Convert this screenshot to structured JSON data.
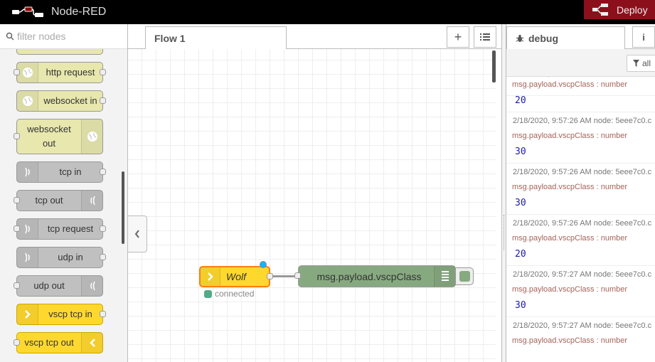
{
  "header": {
    "title": "Node-RED",
    "deploy_label": "Deploy"
  },
  "palette": {
    "search_placeholder": "filter nodes",
    "nodes": [
      {
        "label": "http request"
      },
      {
        "label": "websocket in"
      },
      {
        "label": "websocket out"
      },
      {
        "label": "tcp in"
      },
      {
        "label": "tcp out"
      },
      {
        "label": "tcp request"
      },
      {
        "label": "udp in"
      },
      {
        "label": "udp out"
      },
      {
        "label": "vscp tcp in"
      },
      {
        "label": "vscp tcp out"
      }
    ]
  },
  "workspace": {
    "tabs": [
      {
        "label": "Flow 1"
      }
    ],
    "nodes": {
      "wolf": {
        "label": "Wolf",
        "status": "connected"
      },
      "debug": {
        "label": "msg.payload.vscpClass"
      }
    }
  },
  "sidebar": {
    "tab_label": "debug",
    "filter_label": "all",
    "messages": [
      {
        "meta": "2/18/2020, 9:57:26 AM   node: 5eee7c0.c",
        "topic": "msg.payload.vscpClass : number",
        "value": "20"
      },
      {
        "meta": "2/18/2020, 9:57:26 AM   node: 5eee7c0.c",
        "topic": "msg.payload.vscpClass : number",
        "value": "30"
      },
      {
        "meta": "2/18/2020, 9:57:26 AM   node: 5eee7c0.c",
        "topic": "msg.payload.vscpClass : number",
        "value": "30"
      },
      {
        "meta": "2/18/2020, 9:57:26 AM   node: 5eee7c0.c",
        "topic": "msg.payload.vscpClass : number",
        "value": "20"
      },
      {
        "meta": "2/18/2020, 9:57:27 AM   node: 5eee7c0.c",
        "topic": "msg.payload.vscpClass : number",
        "value": "30"
      },
      {
        "meta": "2/18/2020, 9:57:27 AM   node: 5eee7c0.c",
        "topic": "msg.payload.vscpClass : number",
        "value": ""
      }
    ]
  },
  "colors": {
    "header_bg": "#000000",
    "deploy_bg": "#8c101c",
    "network_node": "#e7e7ae",
    "tcp_node": "#c0c0c0",
    "vscp_node": "#ffd82e",
    "debug_node": "#87a980",
    "selected_outline": "#ff7f0e"
  }
}
